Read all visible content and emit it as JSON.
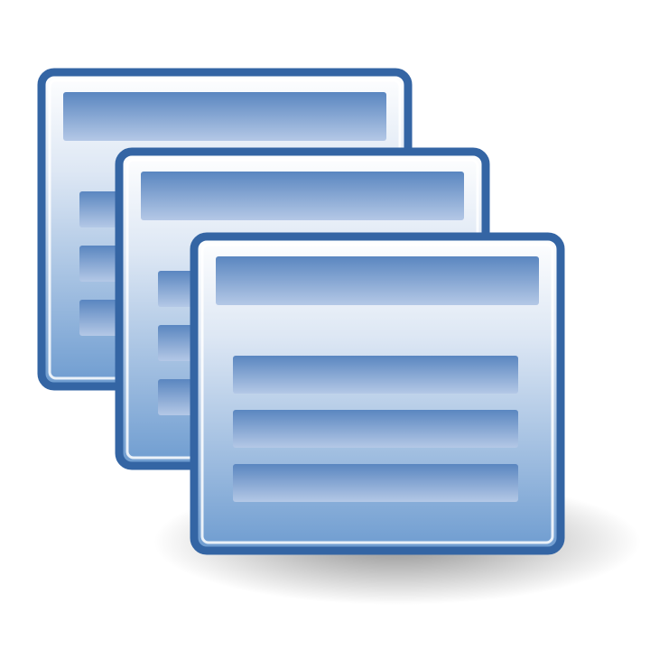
{
  "icon": {
    "name": "window-stack-icon",
    "window_count": 3
  },
  "colors": {
    "border": "#3465a4",
    "border_light": "#ffffff",
    "bar_dark": "#5a86c0",
    "bar_light": "#b4c8e6",
    "panel_top": "#ffffff",
    "panel_mid": "#dde7f4",
    "panel_bottom": "#6e9cd0",
    "shadow": "#000000"
  }
}
